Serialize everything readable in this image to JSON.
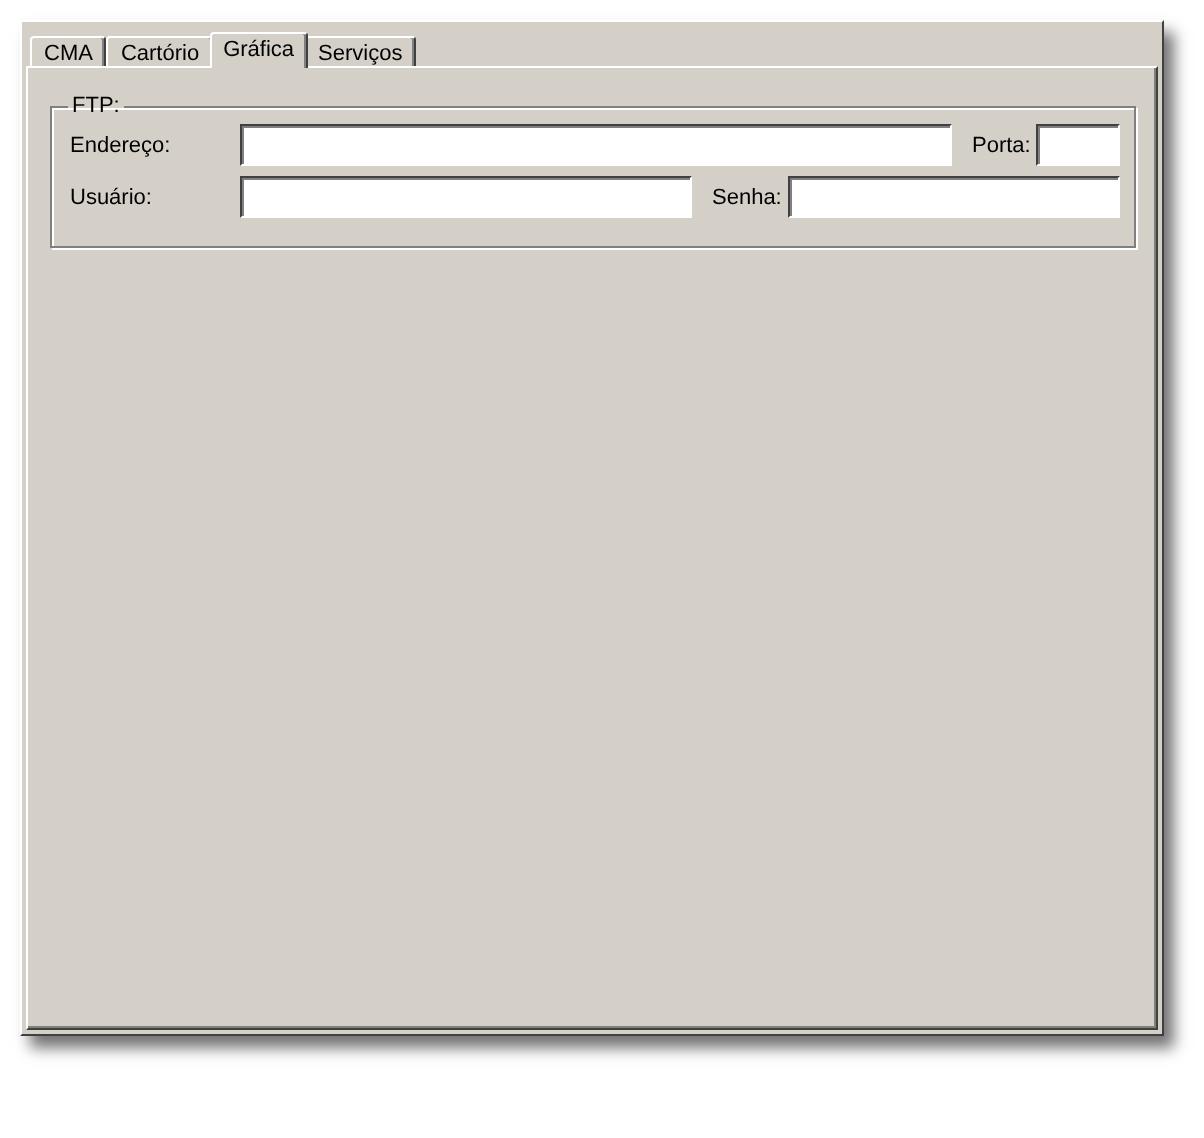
{
  "tabs": [
    {
      "label": "CMA",
      "selected": false
    },
    {
      "label": "Cartório",
      "selected": false
    },
    {
      "label": "Gráfica",
      "selected": true
    },
    {
      "label": "Serviços",
      "selected": false
    }
  ],
  "group": {
    "title": "FTP:",
    "rows": [
      {
        "fields": [
          {
            "label": "Endereço:"
          },
          {
            "label": "Porta:"
          }
        ]
      },
      {
        "fields": [
          {
            "label": "Usuário:"
          },
          {
            "label": "Senha:"
          }
        ]
      }
    ]
  }
}
